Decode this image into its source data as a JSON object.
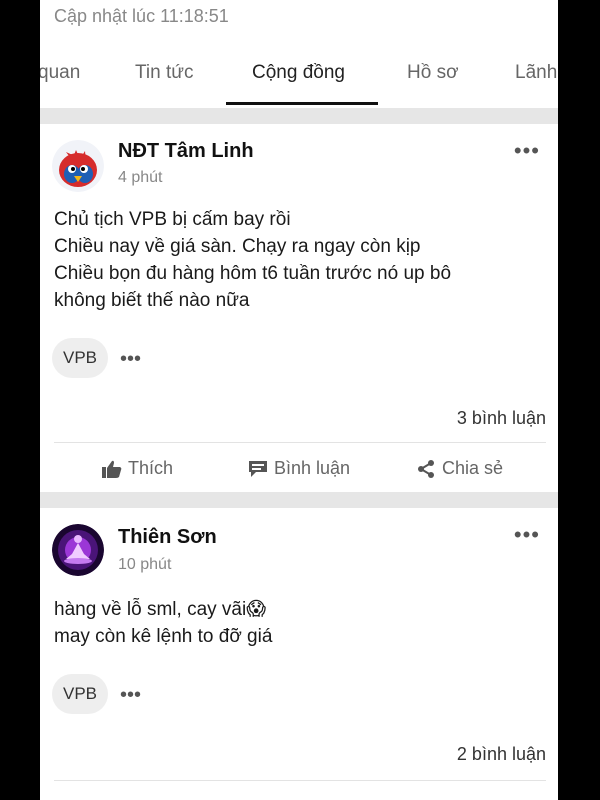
{
  "header": {
    "updated_text": "Cập nhật lúc 11:18:51"
  },
  "tabs": [
    {
      "label": "quan"
    },
    {
      "label": "Tin tức"
    },
    {
      "label": "Cộng đồng"
    },
    {
      "label": "Hồ sơ"
    },
    {
      "label": "Lãnh"
    }
  ],
  "posts": [
    {
      "author": "NĐT Tâm Linh",
      "time": "4 phút",
      "lines": [
        "Chủ tịch VPB bị cấm bay rồi",
        "Chiều nay về giá sàn. Chạy ra ngay còn kịp",
        "Chiều bọn đu hàng hôm t6 tuần trước nó up bô",
        "không biết thế nào nữa"
      ],
      "tag": "VPB",
      "comments": "3 bình luận",
      "actions": {
        "like": "Thích",
        "comment": "Bình luận",
        "share": "Chia sẻ"
      }
    },
    {
      "author": "Thiên Sơn",
      "time": "10 phút",
      "lines": [
        "hàng về lỗ sml, cay vãi😱",
        "may còn kê lệnh to đỡ giá"
      ],
      "tag": "VPB",
      "comments": "2 bình luận"
    }
  ],
  "colors": {
    "background": "#ffffff",
    "divider": "#e6e6e6",
    "active_tab": "#111111"
  }
}
